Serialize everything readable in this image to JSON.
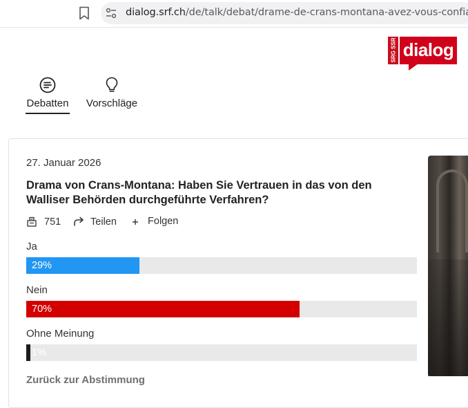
{
  "browser": {
    "url_host": "dialog.srf.ch",
    "url_path": "/de/talk/debat/drame-de-crans-montana-avez-vous-confiance"
  },
  "logo": {
    "srg_text": "SRG SSR",
    "brand": "dialog"
  },
  "nav": {
    "tabs": [
      {
        "label": "Debatten",
        "icon": "debate-list-icon",
        "active": true
      },
      {
        "label": "Vorschläge",
        "icon": "lightbulb-icon",
        "active": false
      }
    ]
  },
  "poll": {
    "date": "27. Januar 2026",
    "title": "Drama von Crans-Montana: Haben Sie Vertrauen in das von den Walliser Behörden durchgeführte Verfahren?",
    "votes": "751",
    "share_label": "Teilen",
    "follow_label": "Folgen",
    "options": [
      {
        "label": "Ja",
        "percent_text": "29%",
        "percent": 29,
        "color": "#2196f3"
      },
      {
        "label": "Nein",
        "percent_text": "70%",
        "percent": 70,
        "color": "#d40000"
      },
      {
        "label": "Ohne Meinung",
        "percent_text": "1%",
        "percent": 1,
        "color": "#1c1c1c"
      }
    ],
    "back_label": "Zurück zur Abstimmung"
  },
  "colors": {
    "brand_red": "#d0021b",
    "bar_track": "#e9e9e9"
  }
}
